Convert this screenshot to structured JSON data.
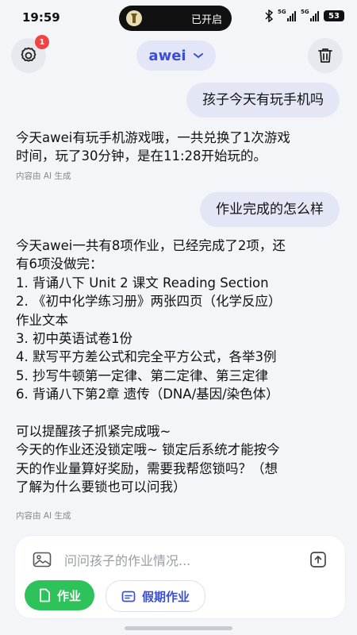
{
  "status_bar": {
    "time": "19:59",
    "island_label": "已开启",
    "network_1": "5G",
    "network_2": "5G",
    "battery": "53"
  },
  "header": {
    "child_name": "awei",
    "settings_badge": "1",
    "settings_icon": "gear-icon",
    "delete_icon": "trash-icon"
  },
  "messages": [
    {
      "role": "user",
      "text": "孩子今天有玩手机吗"
    },
    {
      "role": "ai",
      "text": "今天awei有玩手机游戏哦，一共兑换了1次游戏\n时间，玩了30分钟，是在11:28开始玩的。",
      "note": "内容由 AI 生成"
    },
    {
      "role": "user",
      "text": "作业完成的怎么样"
    },
    {
      "role": "ai",
      "text": "今天awei一共有8项作业，已经完成了2项，还\n有6项没做完：\n1. 背诵八下 Unit 2 课文 Reading Section\n2. 《初中化学练习册》两张四页（化学反应）\n作业文本\n3. 初中英语试卷1份\n4. 默写平方差公式和完全平方公式，各举3例\n5. 抄写牛顿第一定律、第二定律、第三定律\n6. 背诵八下第2章 遗传（DNA/基因/染色体）\n\n可以提醒孩子抓紧完成哦~\n今天的作业还没锁定哦~ 锁定后系统才能按今\n天的作业量算好奖励，需要我帮您锁吗？（想\n了解为什么要锁也可以问我）",
      "note": "内容由 AI 生成"
    }
  ],
  "input": {
    "placeholder": "问问孩子的作业情况...",
    "value": ""
  },
  "chips": {
    "homework": "作业",
    "holiday_homework": "假期作业"
  },
  "colors": {
    "accent": "#3a4fd6",
    "homework_chip": "#2ec25b",
    "badge": "#ef4444",
    "user_bubble": "#e3e6f4"
  }
}
